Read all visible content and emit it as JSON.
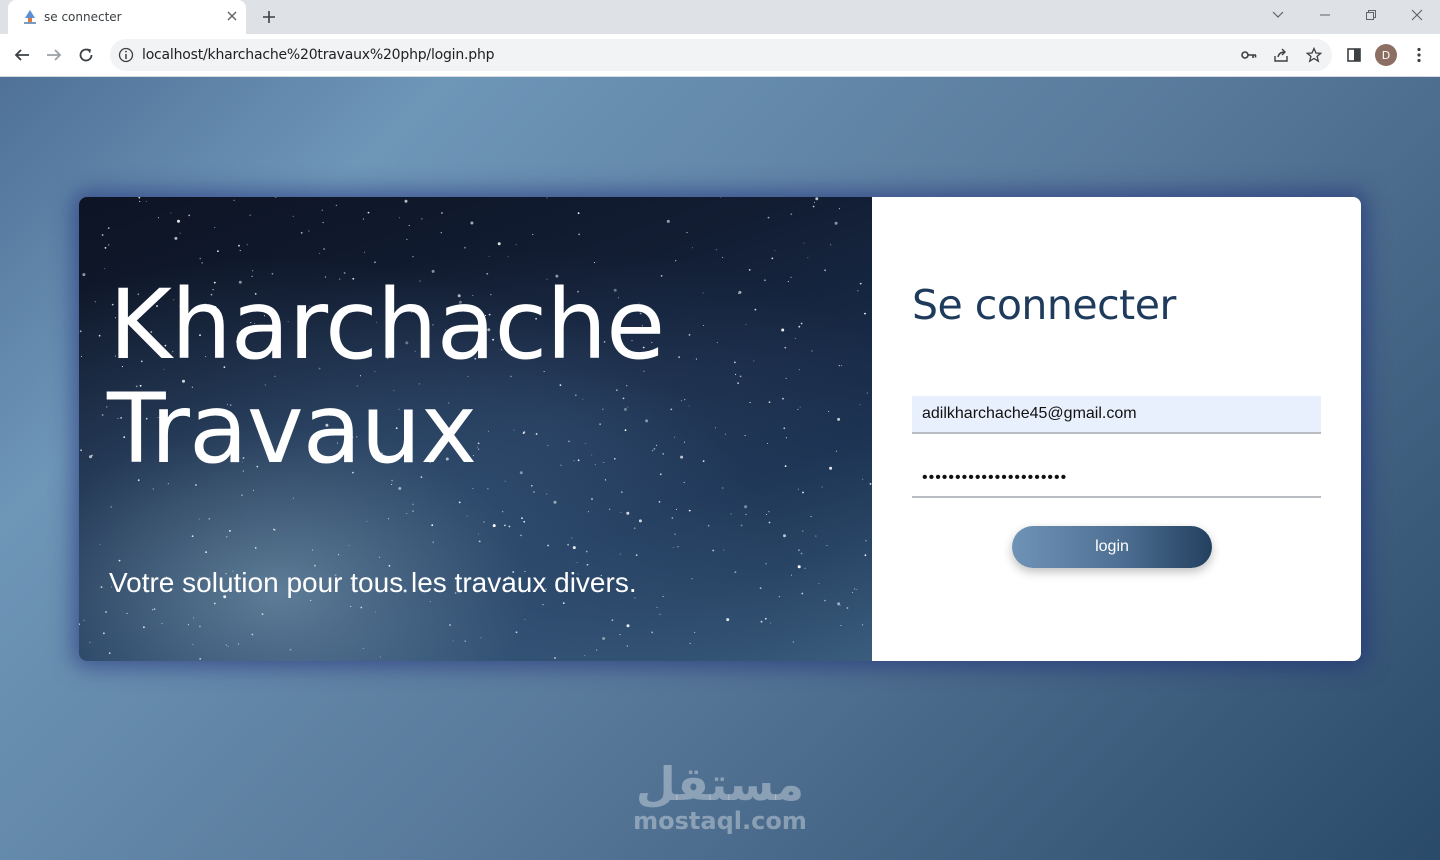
{
  "browser": {
    "tab": {
      "title": "se connecter",
      "close_icon": "close-icon"
    },
    "url": "localhost/kharchache%20travaux%20php/login.php",
    "profile_initial": "D"
  },
  "page": {
    "hero": {
      "title_line1": "Kharchache",
      "title_line2": "Travaux",
      "tagline": "Votre solution pour tous les travaux divers."
    },
    "form": {
      "title": "Se connecter",
      "email_value": "adilkharchache45@gmail.com",
      "password_value": "••••••••••••••••••••••",
      "login_label": "login"
    },
    "watermark": {
      "arabic": "مستقل",
      "latin": "mostaql.com"
    }
  },
  "colors": {
    "title": "#1f3b5c",
    "button_start": "#6f93b6",
    "button_end": "#23405f",
    "email_bg": "#e8f0fe"
  }
}
